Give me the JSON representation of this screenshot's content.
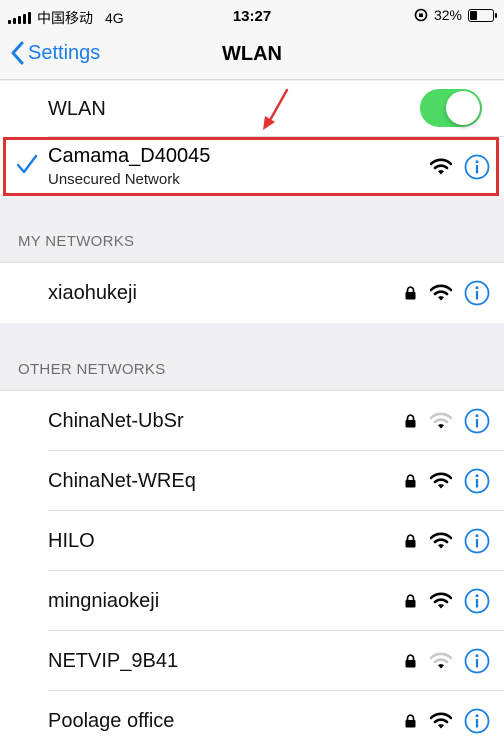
{
  "status_bar": {
    "carrier": "中国移动",
    "network": "4G",
    "time": "13:27",
    "battery": "32%",
    "battery_level": 0.32
  },
  "nav": {
    "back_label": "Settings",
    "title": "WLAN"
  },
  "wlan_toggle": {
    "label": "WLAN",
    "enabled": true
  },
  "connected": {
    "name": "Camama_D40045",
    "subtitle": "Unsecured Network"
  },
  "my_networks": {
    "header": "MY NETWORKS",
    "items": [
      {
        "name": "xiaohukeji",
        "locked": true,
        "signal": 3
      }
    ]
  },
  "other_networks": {
    "header": "OTHER NETWORKS",
    "items": [
      {
        "name": "ChinaNet-UbSr",
        "locked": true,
        "signal": 1
      },
      {
        "name": "ChinaNet-WREq",
        "locked": true,
        "signal": 3
      },
      {
        "name": "HILO",
        "locked": true,
        "signal": 3
      },
      {
        "name": "mingniaokeji",
        "locked": true,
        "signal": 3
      },
      {
        "name": "NETVIP_9B41",
        "locked": true,
        "signal": 1
      },
      {
        "name": "Poolage office",
        "locked": true,
        "signal": 3
      }
    ]
  },
  "colors": {
    "accent": "#1a7ee6",
    "toggle_on": "#4cd964",
    "annotation": "#e03232"
  },
  "icons": {
    "back": "chevron-left-icon",
    "check": "checkmark-icon",
    "lock": "lock-icon",
    "wifi": "wifi-icon",
    "info": "info-icon"
  }
}
